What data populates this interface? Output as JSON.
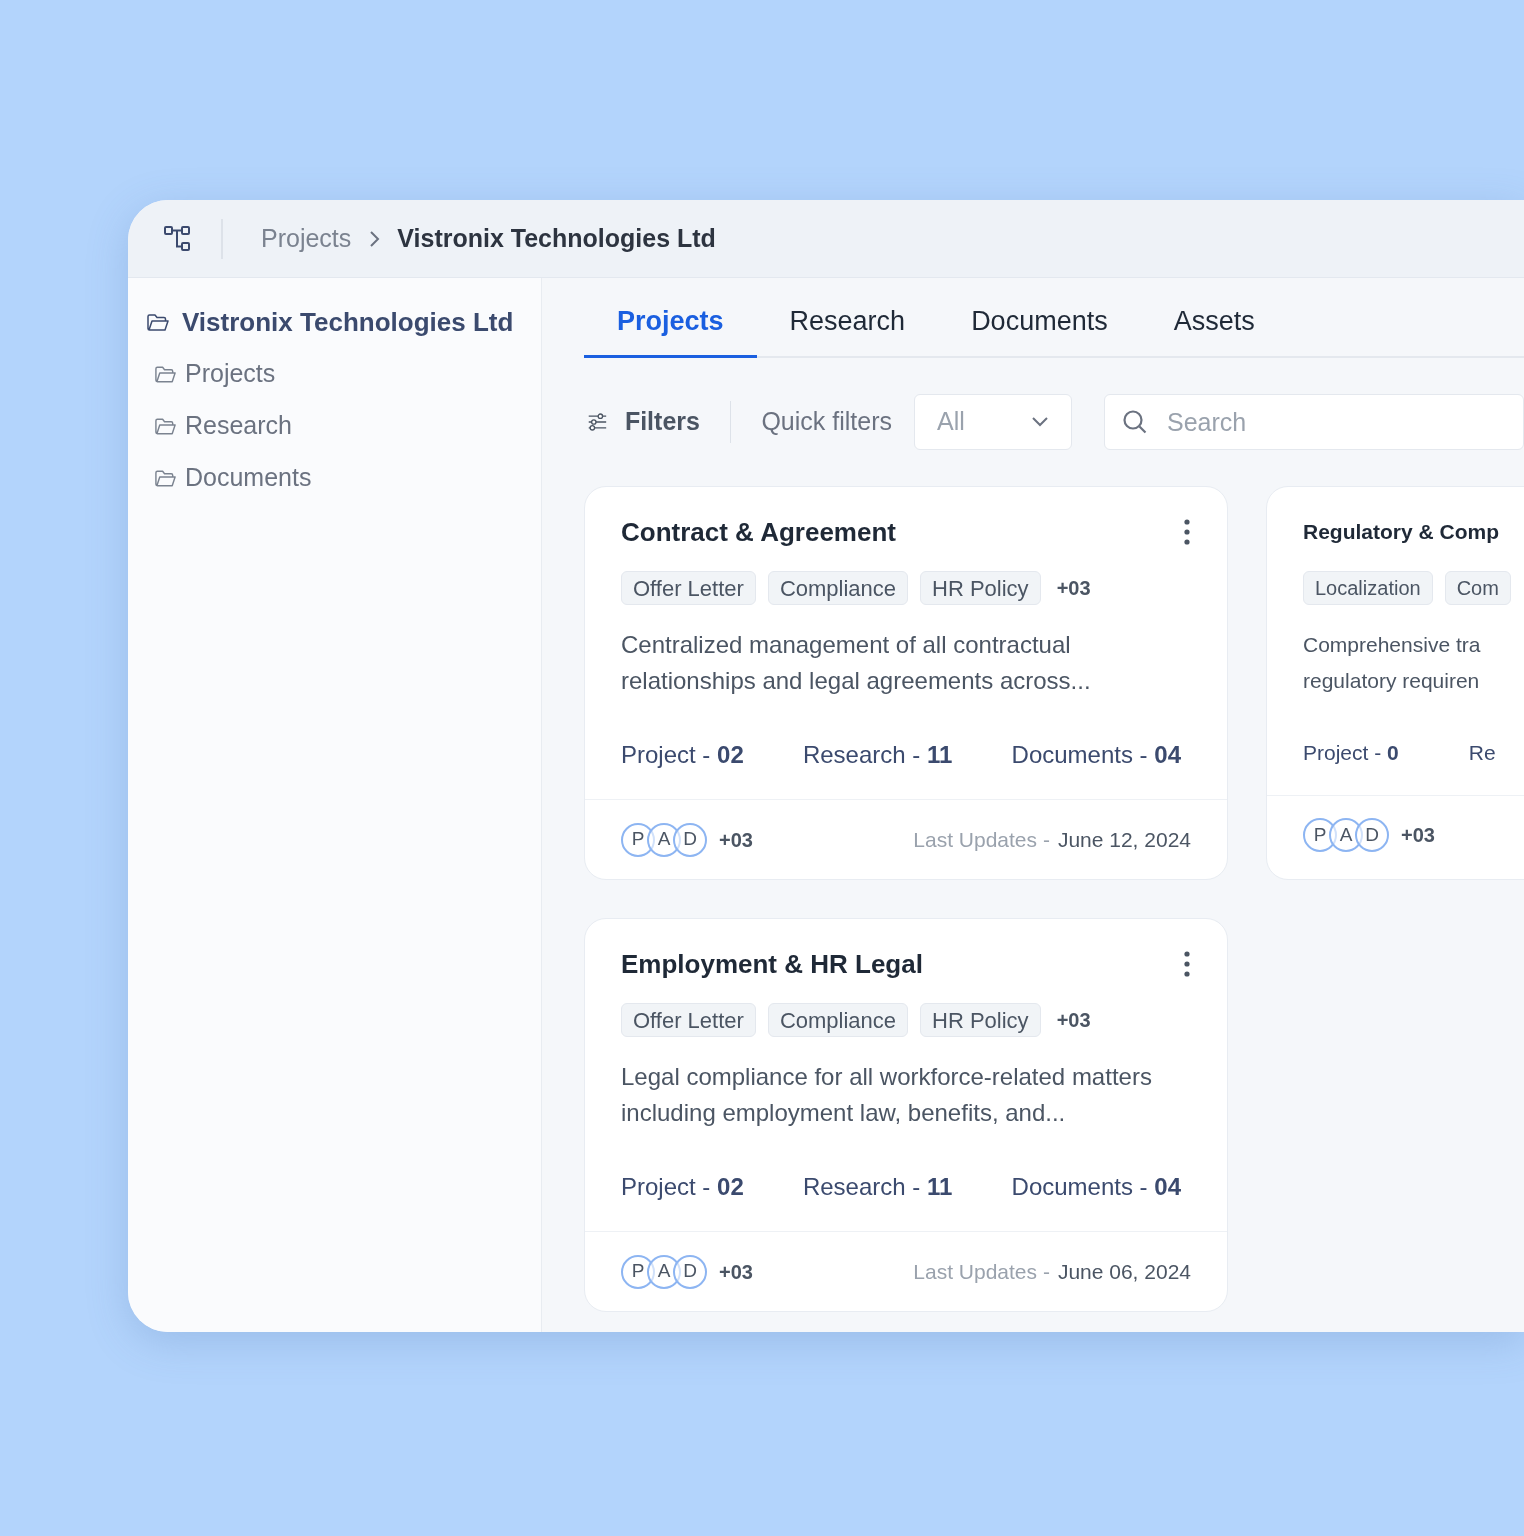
{
  "breadcrumb": [
    {
      "label": "Projects",
      "current": false
    },
    {
      "label": "Vistronix Technologies Ltd",
      "current": true
    }
  ],
  "sidebar": {
    "root": "Vistronix Technologies Ltd",
    "items": [
      "Projects",
      "Research",
      "Documents"
    ]
  },
  "tabs": [
    {
      "label": "Projects",
      "selected": true
    },
    {
      "label": "Research",
      "selected": false
    },
    {
      "label": "Documents",
      "selected": false
    },
    {
      "label": "Assets",
      "selected": false
    }
  ],
  "toolbar": {
    "filters": "Filters",
    "quick_filters": "Quick filters",
    "dropdown_value": "All",
    "search_placeholder": "Search"
  },
  "cards": [
    {
      "kind": "full",
      "title": "Contract & Agreement",
      "tags": [
        "Offer Letter",
        "Compliance",
        "HR Policy"
      ],
      "more_tags": "+03",
      "description": "Centralized management of all contractual relationships and legal agreements across...",
      "stats": [
        {
          "label": "Project -",
          "value": "02"
        },
        {
          "label": "Research -",
          "value": "11"
        },
        {
          "label": "Documents -",
          "value": "04"
        }
      ],
      "avatars": [
        "P",
        "A",
        "D"
      ],
      "more_people": "+03",
      "updated_label": "Last Updates -",
      "updated_date": "June 12, 2024"
    },
    {
      "kind": "cut",
      "title": "Regulatory & Comp",
      "tags": [
        "Localization",
        "Com"
      ],
      "description_lines": [
        "Comprehensive tra",
        "regulatory requiren"
      ],
      "stats": [
        {
          "label": "Project -",
          "value": "0"
        },
        {
          "label": "Re"
        }
      ],
      "avatars": [
        "P",
        "A",
        "D"
      ],
      "more_people": "+03"
    },
    {
      "kind": "full",
      "title": "Employment & HR Legal",
      "tags": [
        "Offer Letter",
        "Compliance",
        "HR Policy"
      ],
      "more_tags": "+03",
      "description": "Legal compliance for all workforce-related matters including employment law, benefits, and...",
      "stats": [
        {
          "label": "Project -",
          "value": "02"
        },
        {
          "label": "Research -",
          "value": "11"
        },
        {
          "label": "Documents -",
          "value": "04"
        }
      ],
      "avatars": [
        "P",
        "A",
        "D"
      ],
      "more_people": "+03",
      "updated_label": "Last Updates -",
      "updated_date": "June 06, 2024"
    }
  ]
}
